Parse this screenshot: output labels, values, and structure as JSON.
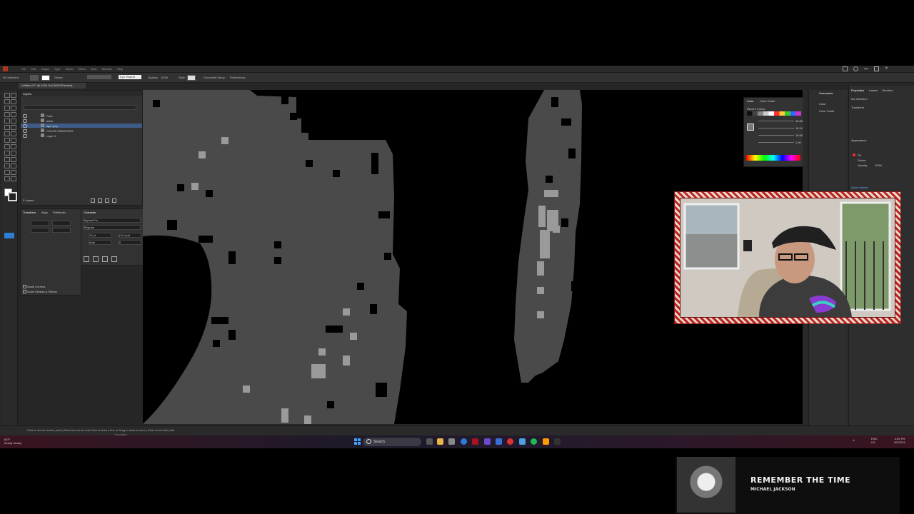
{
  "app": {
    "menus": [
      "File",
      "Edit",
      "Object",
      "Type",
      "Select",
      "Effect",
      "View",
      "Window",
      "Help"
    ],
    "control_bar": {
      "selection_label": "No Selection",
      "stroke_label": "Stroke:",
      "stroke_style": "5 pt. Round",
      "opacity_label": "Opacity:",
      "opacity_value": "100%",
      "style_label": "Style:",
      "doc_setup_button": "Document Setup",
      "preferences_button": "Preferences"
    },
    "document_tab": "Untitled-17* @ 2400 % (CMYK/Preview)",
    "layers_panel": {
      "title": "Layers",
      "rows": [
        {
          "name": "Face",
          "selected": false
        },
        {
          "name": "black",
          "selected": false
        },
        {
          "name": "light grey",
          "selected": true
        },
        {
          "name": "COLOR SWATCHES",
          "selected": false
        },
        {
          "name": "Layer 1",
          "selected": false
        }
      ],
      "footer_count": "5 Layers"
    },
    "transform_panel": {
      "tabs": [
        "Transform",
        "Align",
        "Pathfinder"
      ],
      "options": [
        "Scale Corners",
        "Scale Strokes & Effects"
      ]
    },
    "character_panel": {
      "title": "Character",
      "font": "Myriad Pro",
      "style": "Regular",
      "size": "12 pt",
      "leading": "(14.4 pt)",
      "tracking": "Auto",
      "kerning": "0"
    },
    "color_panel": {
      "tabs": [
        "Color",
        "Color Guide"
      ],
      "recent_label": "Recent Colors",
      "values": [
        "45.88",
        "19.34",
        "15.68",
        "1.96"
      ]
    },
    "comments_panel": {
      "title": "Comments",
      "items": [
        "Color",
        "Color Guide"
      ]
    },
    "properties_panel": {
      "tabs": [
        "Properties",
        "Layers",
        "Libraries"
      ],
      "no_selection": "No Selection",
      "section_transform": "Transform",
      "section_appearance": "Appearance",
      "fill_label": "Fill",
      "stroke_label": "Stroke",
      "opacity_label": "Opacity",
      "opacity_value": "100%",
      "quick_actions": "Quick Actions"
    },
    "status_bar": {
      "hint": "Click to set an anchor point  |  Move the cursor and Click to draw a line or Drag to draw a curve  |  Enter to end the path",
      "tool_name": "Curvature"
    }
  },
  "taskbar": {
    "weather_temp": "63°F",
    "weather_desc": "Mostly cloudy",
    "search_placeholder": "Search",
    "lang": "ENG",
    "region": "US",
    "time": "4:35 PM",
    "date": "5/5/2024"
  },
  "music": {
    "title": "REMEMBER THE TIME",
    "artist": "MICHAEL JACKSON"
  },
  "colors": {
    "accent_blue": "#3d5b86",
    "webcam_frame": "#b22222",
    "canvas_gray": "#4a4a4a",
    "canvas_light": "#9a9a9a"
  }
}
